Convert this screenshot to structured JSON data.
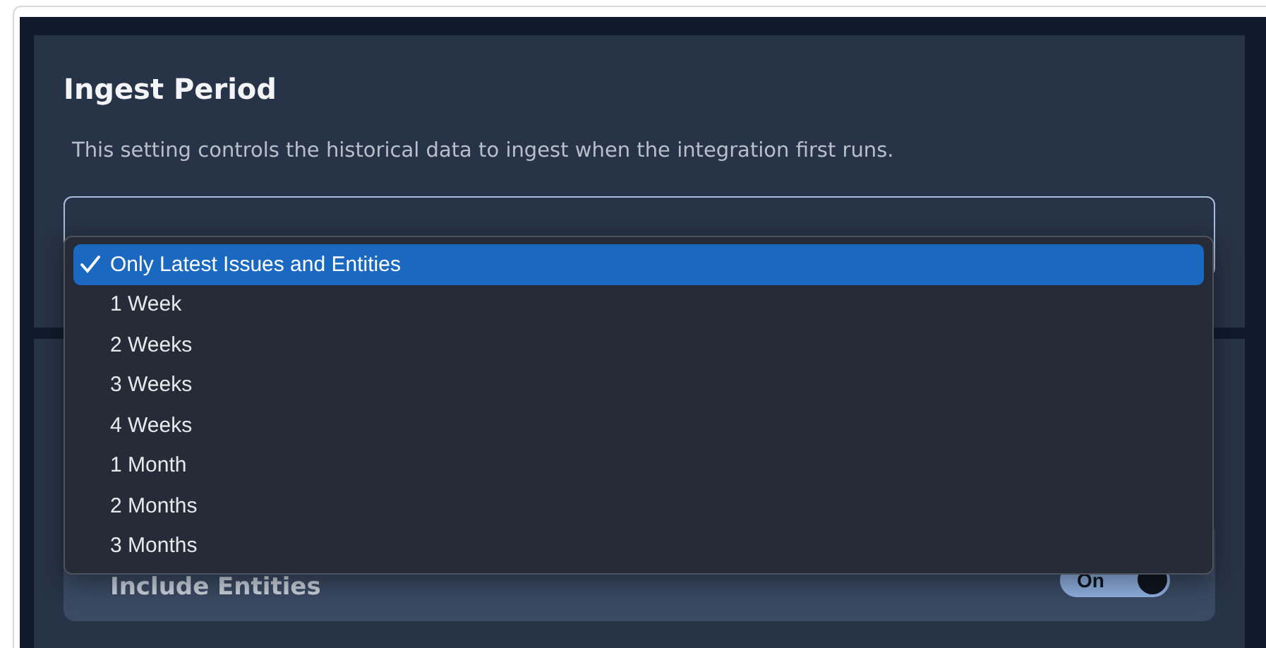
{
  "ingest_period": {
    "title": "Ingest Period",
    "description": "This setting controls the historical data to ingest when the integration first runs."
  },
  "period_menu": {
    "options": [
      {
        "label": "Only Latest Issues and Entities",
        "selected": true
      },
      {
        "label": "1 Week",
        "selected": false
      },
      {
        "label": "2 Weeks",
        "selected": false
      },
      {
        "label": "3 Weeks",
        "selected": false
      },
      {
        "label": "4 Weeks",
        "selected": false
      },
      {
        "label": "1 Month",
        "selected": false
      },
      {
        "label": "2 Months",
        "selected": false
      },
      {
        "label": "3 Months",
        "selected": false
      }
    ]
  },
  "include_entities": {
    "label": "Include Entities",
    "toggle": {
      "label": "On",
      "on": true
    }
  }
}
